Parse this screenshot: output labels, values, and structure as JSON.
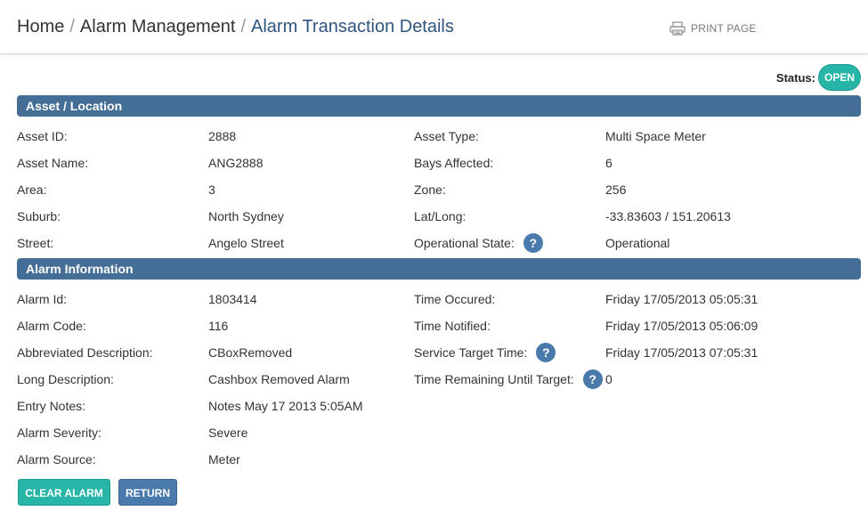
{
  "breadcrumb": {
    "home": "Home",
    "separator": "/",
    "section": "Alarm Management",
    "current": "Alarm Transaction Details"
  },
  "print_page": {
    "label": "PRINT PAGE",
    "icon": "printer-icon"
  },
  "status": {
    "label": "Status:",
    "value": "OPEN",
    "color": "#26b5a6"
  },
  "sections": {
    "asset": {
      "title": "Asset / Location"
    },
    "alarm": {
      "title": "Alarm Information"
    }
  },
  "asset": {
    "asset_id": {
      "label": "Asset ID:",
      "value": "2888"
    },
    "asset_name": {
      "label": "Asset Name:",
      "value": "ANG2888"
    },
    "area": {
      "label": "Area:",
      "value": "3"
    },
    "suburb": {
      "label": "Suburb:",
      "value": "North Sydney"
    },
    "street": {
      "label": "Street:",
      "value": "Angelo Street"
    },
    "asset_type": {
      "label": "Asset Type:",
      "value": "Multi Space Meter"
    },
    "bays_affected": {
      "label": "Bays Affected:",
      "value": "6"
    },
    "zone": {
      "label": "Zone:",
      "value": "256"
    },
    "lat_long": {
      "label": "Lat/Long:",
      "value": "-33.83603 / 151.20613"
    },
    "operational_state": {
      "label": "Operational State:",
      "value": "Operational"
    }
  },
  "alarm": {
    "alarm_id": {
      "label": "Alarm Id:",
      "value": "1803414"
    },
    "alarm_code": {
      "label": "Alarm Code:",
      "value": "116"
    },
    "abbreviated_description": {
      "label": "Abbreviated Description:",
      "value": "CBoxRemoved"
    },
    "long_description": {
      "label": "Long Description:",
      "value": "Cashbox Removed Alarm"
    },
    "entry_notes": {
      "label": "Entry Notes:",
      "value": "Notes May 17 2013 5:05AM"
    },
    "alarm_severity": {
      "label": "Alarm Severity:",
      "value": "Severe"
    },
    "alarm_source": {
      "label": "Alarm Source:",
      "value": "Meter"
    },
    "time_occured": {
      "label": "Time Occured:",
      "value": "Friday 17/05/2013 05:05:31"
    },
    "time_notified": {
      "label": "Time Notified:",
      "value": "Friday 17/05/2013 05:06:09"
    },
    "service_target_time": {
      "label": "Service Target Time:",
      "value": "Friday 17/05/2013 07:05:31"
    },
    "time_remaining": {
      "label": "Time Remaining Until Target:",
      "value": "0"
    }
  },
  "help_icon": {
    "glyph": "?",
    "icon": "help-icon"
  },
  "buttons": {
    "clear_alarm": "CLEAR ALARM",
    "return": "RETURN"
  },
  "colors": {
    "section_bar": "#456e96",
    "primary_button": "#26b5a6",
    "secondary_button": "#4a7aab",
    "breadcrumb_current": "#2f5680"
  }
}
